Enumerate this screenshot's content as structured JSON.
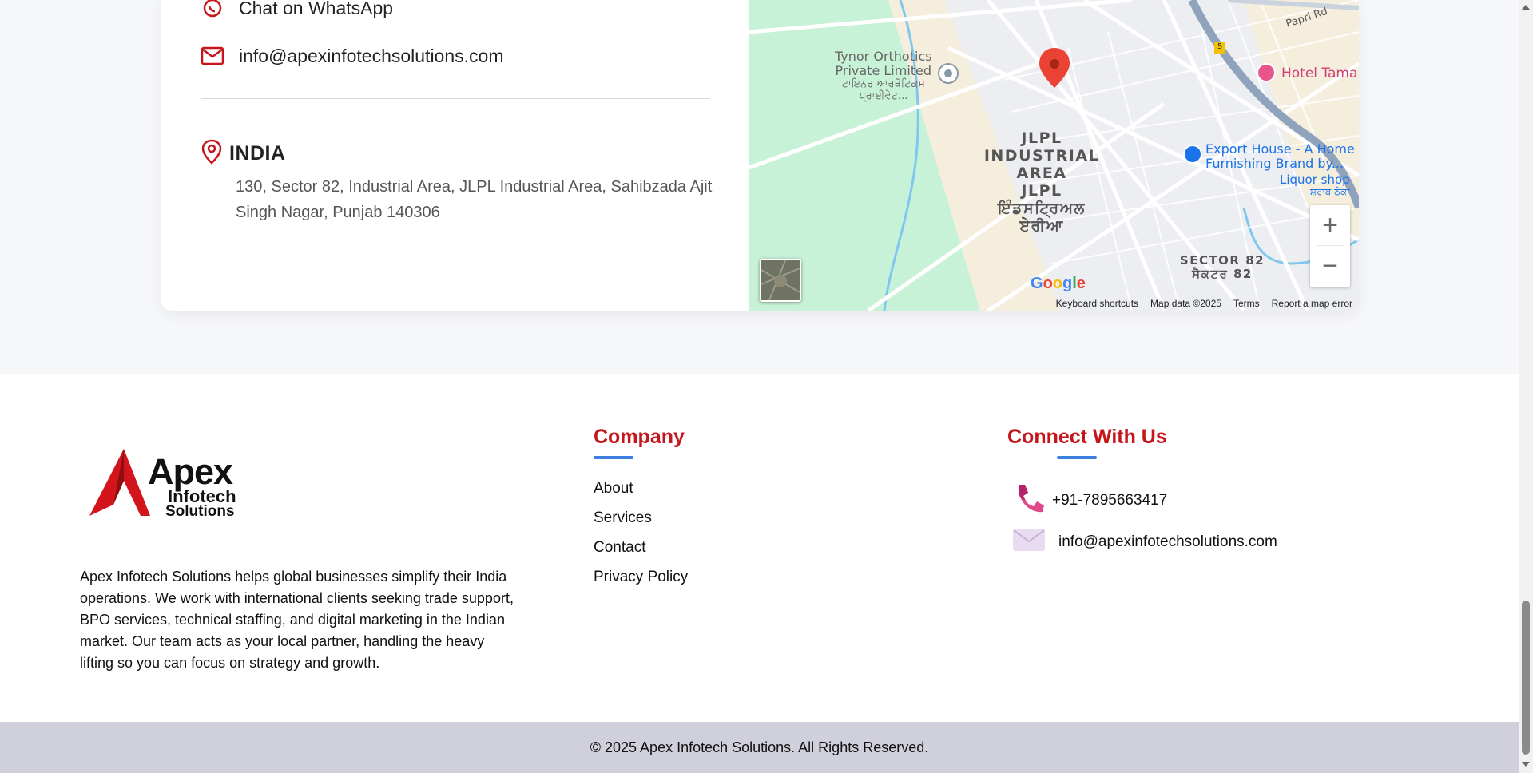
{
  "contact": {
    "whatsapp_label": "Chat on WhatsApp",
    "email": "info@apexinfotechsolutions.com",
    "country": "INDIA",
    "address": "130, Sector 82, Industrial Area, JLPL Industrial Area, Sahibzada Ajit Singh Nagar, Punjab 140306"
  },
  "map": {
    "poi_tynor_line1": "Tynor Orthotics",
    "poi_tynor_line2": "Private Limited",
    "poi_tynor_pa1": "ਟਾਇਨਰ ਆਰਥੋਟਿਕਸ",
    "poi_tynor_pa2": "ਪ੍ਰਾਈਵੇਟ...",
    "area_line1": "JLPL",
    "area_line2": "INDUSTRIAL AREA",
    "area_line3": "JLPL",
    "area_pa1": "ਇੰਡਸਟ੍ਰਿਅਲ",
    "area_pa2": "ਏਰੀਆ",
    "hotel": "Hotel Tama",
    "export_line1": "Export House - A Home",
    "export_line2": "Furnishing Brand by...",
    "liquor": "Liquor shop",
    "liquor_pa": "ਸ਼ਰਾਬ ਠੇਕਾ",
    "sector_line1": "SECTOR 82",
    "sector_line2": "ਸੈਕਟਰ 82",
    "road_label": "Papri Rd",
    "highway_badge": "5",
    "google_logo": "Google",
    "zoom_in": "+",
    "zoom_out": "−",
    "attribution": {
      "shortcuts": "Keyboard shortcuts",
      "data": "Map data ©2025",
      "terms": "Terms",
      "report": "Report a map error"
    }
  },
  "footer": {
    "logo_title": "Apex",
    "logo_sub1": "Infotech",
    "logo_sub2": "Solutions",
    "about": "Apex Infotech Solutions helps global businesses simplify their India operations. We work with international clients seeking trade support, BPO services, technical staffing, and digital marketing in the Indian market. Our team acts as your local partner, handling the heavy lifting so you can focus on strategy and growth.",
    "company_heading": "Company",
    "company_links": [
      "About",
      "Services",
      "Contact",
      "Privacy Policy"
    ],
    "connect_heading": "Connect With Us",
    "phone": "+91-7895663417",
    "email": "info@apexinfotechsolutions.com",
    "copyright": "© 2025 Apex Infotech Solutions. All Rights Reserved."
  },
  "colors": {
    "accent_red": "#c4161c",
    "accent_blue": "#3b7fe0",
    "copyright_bg": "#d0d0dc"
  }
}
